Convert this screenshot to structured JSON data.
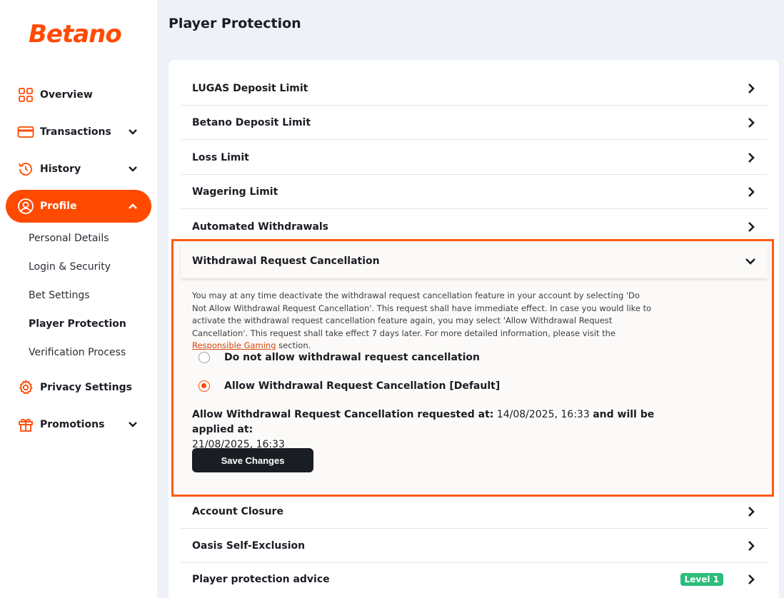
{
  "brand": {
    "logo_text": "Betano",
    "accent": "#ff4a00"
  },
  "sidebar": {
    "items": [
      {
        "label": "Overview",
        "icon": "grid-icon",
        "expandable": false
      },
      {
        "label": "Transactions",
        "icon": "card-icon",
        "expandable": true
      },
      {
        "label": "History",
        "icon": "history-icon",
        "expandable": true
      },
      {
        "label": "Profile",
        "icon": "user-icon",
        "expandable": true,
        "active": true
      },
      {
        "label": "Privacy Settings",
        "icon": "gear-icon",
        "expandable": false
      },
      {
        "label": "Promotions",
        "icon": "gift-icon",
        "expandable": true
      }
    ],
    "profile_subitems": [
      {
        "label": "Personal Details"
      },
      {
        "label": "Login & Security"
      },
      {
        "label": "Bet Settings"
      },
      {
        "label": "Player Protection",
        "current": true
      },
      {
        "label": "Verification Process"
      }
    ]
  },
  "main": {
    "title": "Player Protection",
    "rows_top": [
      {
        "label": "LUGAS Deposit Limit"
      },
      {
        "label": "Betano Deposit Limit"
      },
      {
        "label": "Loss Limit"
      },
      {
        "label": "Wagering Limit"
      },
      {
        "label": "Automated Withdrawals"
      }
    ],
    "expanded": {
      "label": "Withdrawal Request Cancellation",
      "description": "You may at any time deactivate the withdrawal request cancellation feature in your account by selecting 'Do Not Allow Withdrawal Request Cancellation'. This request shall have immediate effect. In case you would like to activate the withdrawal request cancellation feature again, you may select 'Allow Withdrawal Request Cancellation'. This request shall take effect 7 days later. For more detailed information, please visit the",
      "link_text": "Responsible Gaming",
      "description_end": " section.",
      "options": [
        {
          "label": "Do not allow withdrawal request cancellation",
          "checked": false
        },
        {
          "label": "Allow Withdrawal Request Cancellation [Default]",
          "checked": true
        }
      ],
      "status_prefix": "Allow Withdrawal Request Cancellation requested at:",
      "requested_at": " 14/08/2025, 16:33 ",
      "status_mid": "and will be applied at:",
      "applied_at": "21/08/2025, 16:33",
      "save_label": "Save Changes"
    },
    "rows_bottom": [
      {
        "label": "Account Closure"
      },
      {
        "label": "Oasis Self-Exclusion"
      },
      {
        "label": "Player protection advice",
        "badge": "Level 1"
      }
    ]
  }
}
